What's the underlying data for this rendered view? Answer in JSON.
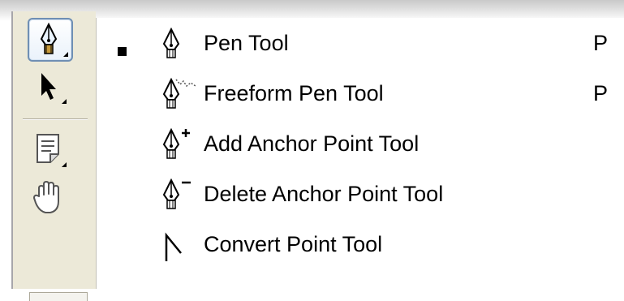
{
  "toolbox": {
    "tools": [
      {
        "name": "pen-tool-button",
        "icon": "pen-icon",
        "active": true
      },
      {
        "name": "path-selection-tool-button",
        "icon": "arrow-pointer-icon",
        "active": false
      },
      {
        "name": "notes-tool-button",
        "icon": "note-icon",
        "active": false
      },
      {
        "name": "hand-tool-button",
        "icon": "hand-icon",
        "active": false
      }
    ]
  },
  "menu": {
    "items": [
      {
        "label": "Pen Tool",
        "shortcut": "P",
        "selected": true,
        "icon": "pen-icon"
      },
      {
        "label": "Freeform Pen Tool",
        "shortcut": "P",
        "selected": false,
        "icon": "freeform-pen-icon"
      },
      {
        "label": "Add Anchor Point Tool",
        "shortcut": "",
        "selected": false,
        "icon": "add-anchor-point-icon"
      },
      {
        "label": "Delete Anchor Point Tool",
        "shortcut": "",
        "selected": false,
        "icon": "delete-anchor-point-icon"
      },
      {
        "label": "Convert Point Tool",
        "shortcut": "",
        "selected": false,
        "icon": "convert-point-icon"
      }
    ]
  },
  "colors": {
    "panel": "#ece9d8",
    "active_border": "#6f8fb4",
    "menu_background": "#ffffff"
  }
}
